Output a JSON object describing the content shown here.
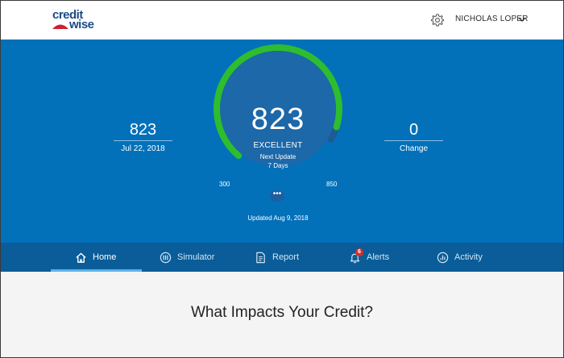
{
  "brand": {
    "logo_line1": "credit",
    "logo_line2": "wise"
  },
  "header": {
    "user_name": "NICHOLAS LOPER",
    "settings_icon": "gear-icon",
    "menu_icon": "chevron-down-icon"
  },
  "score": {
    "current": "823",
    "rating": "EXCELLENT",
    "next_update_label": "Next Update",
    "next_update_value": "7 Days",
    "min_label": "300",
    "max_label": "850",
    "min": 300,
    "max": 850,
    "value": 823,
    "more_label": "•••",
    "updated": "Updated Aug 9, 2018"
  },
  "previous": {
    "value": "823",
    "date": "Jul 22, 2018"
  },
  "change": {
    "value": "0",
    "label": "Change"
  },
  "nav": {
    "home": "Home",
    "simulator": "Simulator",
    "report": "Report",
    "alerts": "Alerts",
    "alerts_count": "6",
    "activity": "Activity"
  },
  "main": {
    "section_title": "What Impacts Your Credit?"
  },
  "colors": {
    "hero_bg": "#0271ba",
    "nav_bg": "#0a5d98",
    "gauge_green": "#2ebd2e",
    "brand_navy": "#1b4b86",
    "brand_red": "#d0202e",
    "alert_red": "#d32f2f"
  }
}
